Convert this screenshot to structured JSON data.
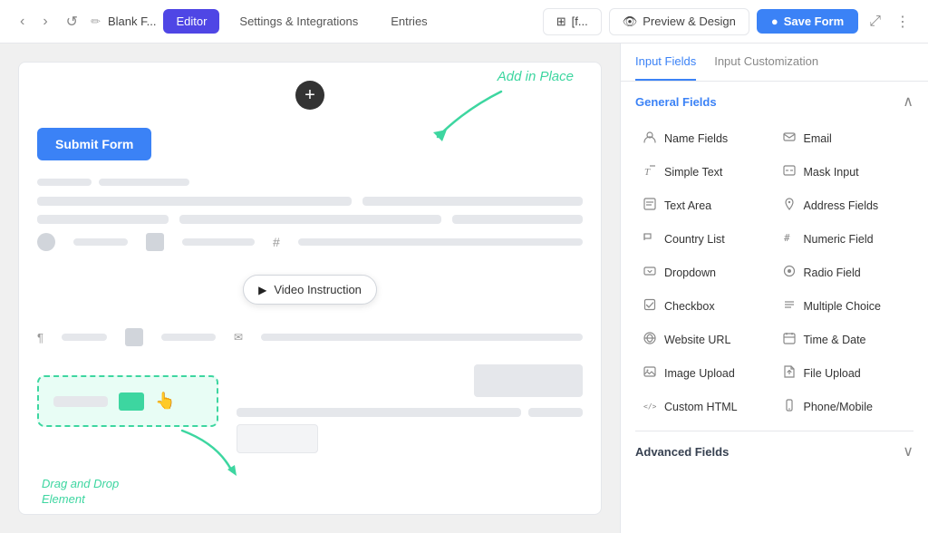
{
  "topbar": {
    "back_label": "‹",
    "forward_label": "›",
    "refresh_label": "↺",
    "file_name": "Blank F...",
    "tabs": [
      {
        "id": "editor",
        "label": "Editor",
        "active": true
      },
      {
        "id": "settings",
        "label": "Settings & Integrations",
        "active": false
      },
      {
        "id": "entries",
        "label": "Entries",
        "active": false
      }
    ],
    "right_btn1_label": "[f...",
    "preview_btn_label": "Preview & Design",
    "save_btn_label": "Save Form"
  },
  "canvas": {
    "add_btn_label": "+",
    "submit_btn_label": "Submit Form",
    "add_in_place_label": "Add in Place",
    "video_btn_label": "Video Instruction",
    "drag_drop_label": "Drag and Drop\nElement"
  },
  "sidebar": {
    "tab_input_fields": "Input Fields",
    "tab_input_customization": "Input Customization",
    "general_section_title": "General Fields",
    "fields": [
      {
        "id": "name-fields",
        "icon": "👤",
        "label": "Name Fields"
      },
      {
        "id": "email",
        "icon": "✉",
        "label": "Email"
      },
      {
        "id": "simple-text",
        "icon": "T",
        "label": "Simple Text"
      },
      {
        "id": "mask-input",
        "icon": "⌨",
        "label": "Mask Input"
      },
      {
        "id": "text-area",
        "icon": "📝",
        "label": "Text Area"
      },
      {
        "id": "address-fields",
        "icon": "📍",
        "label": "Address Fields"
      },
      {
        "id": "country-list",
        "icon": "🏳",
        "label": "Country List"
      },
      {
        "id": "numeric-field",
        "icon": "#",
        "label": "Numeric Field"
      },
      {
        "id": "dropdown",
        "icon": "▽",
        "label": "Dropdown"
      },
      {
        "id": "radio-field",
        "icon": "◎",
        "label": "Radio Field"
      },
      {
        "id": "checkbox",
        "icon": "☑",
        "label": "Checkbox"
      },
      {
        "id": "multiple-choice",
        "icon": "≡",
        "label": "Multiple Choice"
      },
      {
        "id": "website-url",
        "icon": "◇",
        "label": "Website URL"
      },
      {
        "id": "time-date",
        "icon": "📅",
        "label": "Time & Date"
      },
      {
        "id": "image-upload",
        "icon": "🖼",
        "label": "Image Upload"
      },
      {
        "id": "file-upload",
        "icon": "📎",
        "label": "File Upload"
      },
      {
        "id": "custom-html",
        "icon": "</>",
        "label": "Custom HTML"
      },
      {
        "id": "phone-mobile",
        "icon": "📱",
        "label": "Phone/Mobile"
      }
    ],
    "advanced_section_title": "Advanced Fields"
  }
}
